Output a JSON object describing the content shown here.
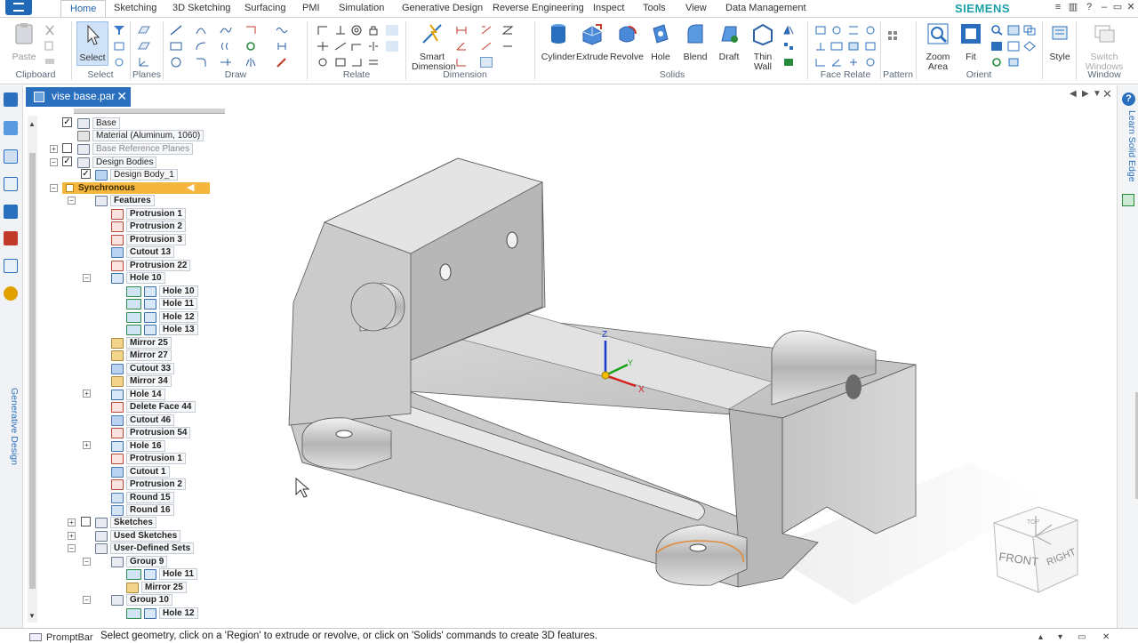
{
  "menu": {
    "tabs": [
      "Home",
      "Sketching",
      "3D Sketching",
      "Surfacing",
      "PMI",
      "Simulation",
      "Generative Design",
      "Reverse Engineering",
      "Inspect",
      "Tools",
      "View",
      "Data Management"
    ],
    "active_tab": "Home",
    "brand": "SIEMENS"
  },
  "ribbon": {
    "groups": {
      "clipboard": "Clipboard",
      "select": "Select",
      "planes": "Planes",
      "draw": "Draw",
      "relate": "Relate",
      "dimension": "Dimension",
      "solids": "Solids",
      "face_relate": "Face Relate",
      "pattern": "Pattern",
      "orient": "Orient",
      "window": "Window"
    },
    "buttons": {
      "paste": "Paste",
      "select": "Select",
      "smart_dimension_1": "Smart",
      "smart_dimension_2": "Dimension",
      "cylinder": "Cylinder",
      "extrude": "Extrude",
      "revolve": "Revolve",
      "hole": "Hole",
      "blend": "Blend",
      "draft": "Draft",
      "thin_wall_1": "Thin",
      "thin_wall_2": "Wall",
      "zoom_area_1": "Zoom",
      "zoom_area_2": "Area",
      "fit": "Fit",
      "style": "Style",
      "switch_windows_1": "Switch",
      "switch_windows_2": "Windows"
    }
  },
  "document": {
    "tab_title": "vise base.par"
  },
  "left_rail": {
    "generative_design": "Generative Design"
  },
  "right_rail": {
    "learn": "Learn Solid Edge",
    "help": "?"
  },
  "tree": {
    "base": "Base",
    "material": "Material (Aluminum, 1060)",
    "base_reference_planes": "Base Reference Planes",
    "design_bodies": "Design Bodies",
    "design_body_1": "Design Body_1",
    "synchronous": "Synchronous",
    "features": "Features",
    "items": [
      {
        "label": "Protrusion 1",
        "kind": "red"
      },
      {
        "label": "Protrusion 2",
        "kind": "red"
      },
      {
        "label": "Protrusion 3",
        "kind": "red"
      },
      {
        "label": "Cutout 13",
        "kind": "blue"
      },
      {
        "label": "Protrusion 22",
        "kind": "red"
      },
      {
        "label": "Hole 10",
        "kind": "hole"
      },
      {
        "label": "Hole 10",
        "kind": "hole"
      },
      {
        "label": "Hole 11",
        "kind": "hole"
      },
      {
        "label": "Hole 12",
        "kind": "hole"
      },
      {
        "label": "Hole 13",
        "kind": "hole"
      },
      {
        "label": "Mirror 25",
        "kind": "mirror"
      },
      {
        "label": "Mirror 27",
        "kind": "mirror"
      },
      {
        "label": "Cutout 33",
        "kind": "blue"
      },
      {
        "label": "Mirror 34",
        "kind": "mirror"
      },
      {
        "label": "Hole 14",
        "kind": "hole"
      },
      {
        "label": "Delete Face 44",
        "kind": "red"
      },
      {
        "label": "Cutout 46",
        "kind": "blue"
      },
      {
        "label": "Protrusion 54",
        "kind": "red"
      },
      {
        "label": "Hole 16",
        "kind": "hole"
      },
      {
        "label": "Protrusion 1",
        "kind": "red"
      },
      {
        "label": "Cutout 1",
        "kind": "blue"
      },
      {
        "label": "Protrusion 2",
        "kind": "red"
      },
      {
        "label": "Round 15",
        "kind": "round"
      },
      {
        "label": "Round 16",
        "kind": "round"
      }
    ],
    "sketches": "Sketches",
    "used_sketches": "Used Sketches",
    "user_defined_sets": "User-Defined Sets",
    "group_9": "Group 9",
    "group_9_hole": "Hole 11",
    "group_9_mirror": "Mirror 25",
    "group_10": "Group 10",
    "group_10_hole": "Hole 12"
  },
  "viewcube": {
    "front": "FRONT",
    "right": "RIGHT",
    "top": "TOP"
  },
  "triad": {
    "x": "X",
    "y": "Y",
    "z": "Z"
  },
  "promptbar": {
    "name": "PromptBar",
    "text": "Select geometry, click on a 'Region' to extrude or revolve, or click on 'Solids' commands to create 3D features."
  },
  "colors": {
    "accent": "#2a6fbe",
    "synchronous": "#f4b63c",
    "brand": "#1aa0a8"
  }
}
